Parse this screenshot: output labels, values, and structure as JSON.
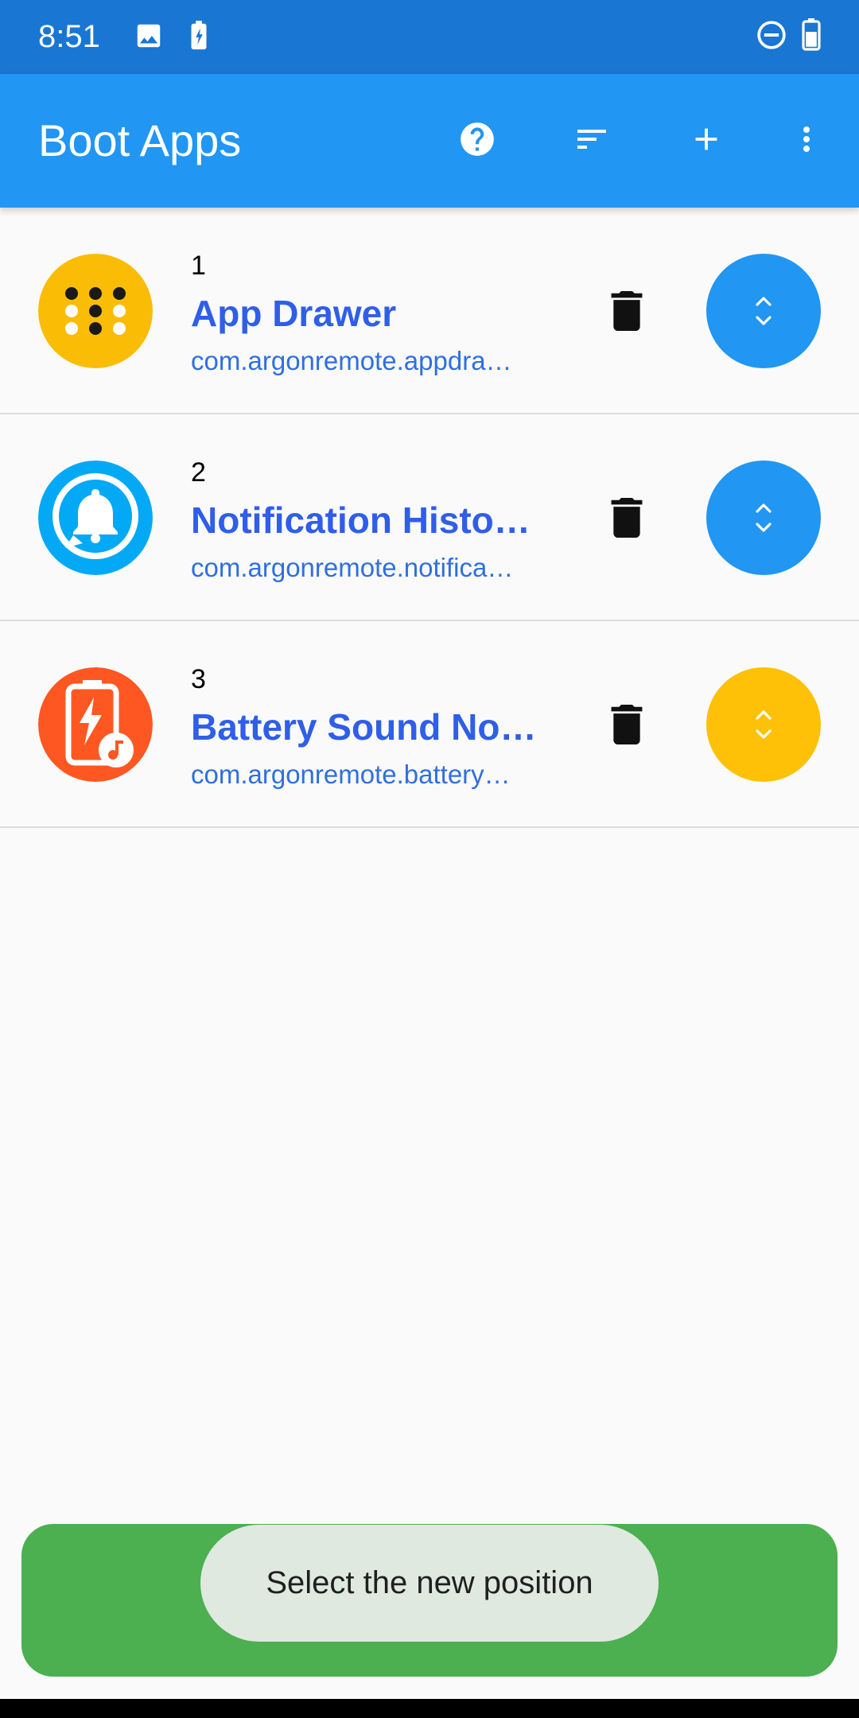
{
  "status_bar": {
    "time": "8:51",
    "icons": [
      "image-icon",
      "battery-charging-icon",
      "do-not-disturb-icon",
      "battery-icon"
    ]
  },
  "app_bar": {
    "title": "Boot Apps",
    "actions": [
      "help-icon",
      "sort-icon",
      "add-icon",
      "more-vert-icon"
    ]
  },
  "apps": [
    {
      "number": "1",
      "name": "App Drawer",
      "package": "com.argonremote.appdra…",
      "icon": "app-drawer-icon",
      "icon_color": "#fbbc05",
      "move_color": "#2196f3"
    },
    {
      "number": "2",
      "name": "Notification Histor…",
      "package": "com.argonremote.notifica…",
      "icon": "notification-bell-icon",
      "icon_color": "#03a9f4",
      "move_color": "#2196f3"
    },
    {
      "number": "3",
      "name": "Battery Sound Noti…",
      "package": "com.argonremote.battery…",
      "icon": "battery-sound-icon",
      "icon_color": "#ff5722",
      "move_color": "#ffc107"
    }
  ],
  "bottom_bar": {
    "color": "#4caf50",
    "icon": "power-icon"
  },
  "toast": {
    "message": "Select the new position"
  },
  "colors": {
    "status_bar": "#1976d2",
    "app_bar": "#2196f3",
    "title_text": "#2f5ee8",
    "package_text": "#2f6fe0"
  }
}
